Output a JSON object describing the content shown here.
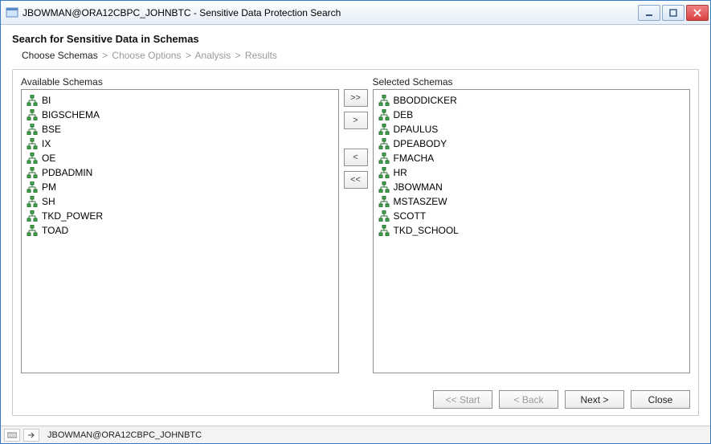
{
  "window": {
    "title": "JBOWMAN@ORA12CBPC_JOHNBTC - Sensitive Data Protection Search"
  },
  "heading": "Search for Sensitive Data in Schemas",
  "breadcrumb": {
    "step1": "Choose Schemas",
    "step2": "Choose Options",
    "step3": "Analysis",
    "step4": "Results"
  },
  "labels": {
    "available": "Available Schemas",
    "selected": "Selected Schemas"
  },
  "availableSchemas": [
    "BI",
    "BIGSCHEMA",
    "BSE",
    "IX",
    "OE",
    "PDBADMIN",
    "PM",
    "SH",
    "TKD_POWER",
    "TOAD"
  ],
  "selectedSchemas": [
    "BBODDICKER",
    "DEB",
    "DPAULUS",
    "DPEABODY",
    "FMACHA",
    "HR",
    "JBOWMAN",
    "MSTASZEW",
    "SCOTT",
    "TKD_SCHOOL"
  ],
  "moveButtons": {
    "addAll": ">>",
    "addOne": ">",
    "removeOne": "<",
    "removeAll": "<<"
  },
  "wizard": {
    "start": "<< Start",
    "back": "< Back",
    "next": "Next >",
    "close": "Close"
  },
  "status": {
    "connection": "JBOWMAN@ORA12CBPC_JOHNBTC"
  }
}
